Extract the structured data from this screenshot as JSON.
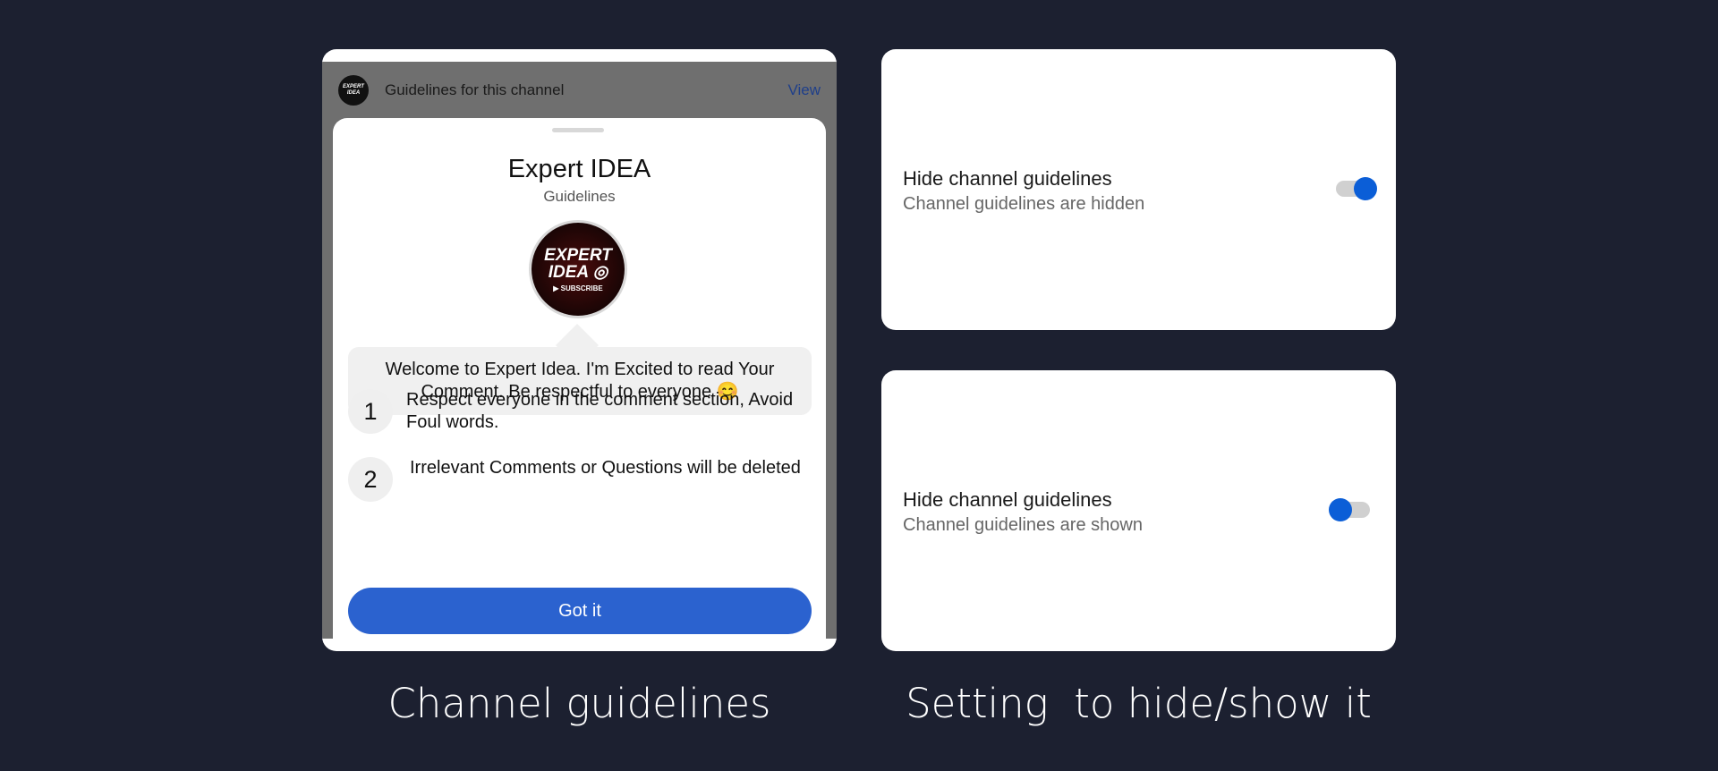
{
  "guidelines_panel": {
    "bar": {
      "avatar_text": "EXPERT IDEA",
      "title": "Guidelines for this channel",
      "view_link": "View"
    },
    "sheet": {
      "title": "Expert IDEA",
      "subtitle": "Guidelines",
      "logo": {
        "line1": "EXPERT",
        "line2": "IDEA ◎",
        "line3": "▶ SUBSCRIBE"
      },
      "welcome": "Welcome to Expert Idea. I'm Excited to read Your Comment. Be respectful to everyone 😊",
      "rules": [
        {
          "number": "1",
          "text": "Respect everyone in the comment section, Avoid Foul words."
        },
        {
          "number": "2",
          "text": "Irrelevant Comments or Questions will be deleted"
        }
      ],
      "button": "Got it"
    }
  },
  "settings": [
    {
      "title": "Hide channel guidelines",
      "description": "Channel guidelines are hidden",
      "toggle_on": true
    },
    {
      "title": "Hide channel guidelines",
      "description": "Channel guidelines are shown",
      "toggle_on": false
    }
  ],
  "captions": {
    "left": "Channel guidelines",
    "right": "Setting  to hide/show it"
  },
  "colors": {
    "background": "#1c2030",
    "accent_blue": "#2b62cf",
    "toggle_blue": "#0b5ed7"
  }
}
